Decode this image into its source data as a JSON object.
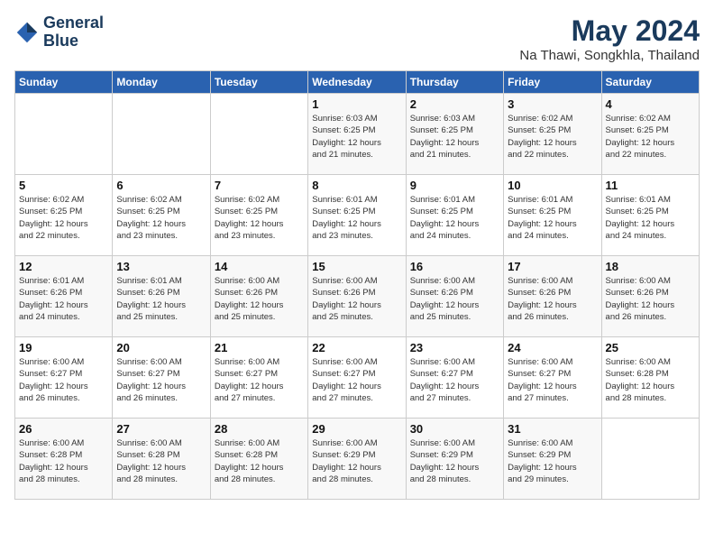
{
  "logo": {
    "line1": "General",
    "line2": "Blue"
  },
  "title": "May 2024",
  "subtitle": "Na Thawi, Songkhla, Thailand",
  "weekdays": [
    "Sunday",
    "Monday",
    "Tuesday",
    "Wednesday",
    "Thursday",
    "Friday",
    "Saturday"
  ],
  "weeks": [
    [
      {
        "day": "",
        "info": ""
      },
      {
        "day": "",
        "info": ""
      },
      {
        "day": "",
        "info": ""
      },
      {
        "day": "1",
        "info": "Sunrise: 6:03 AM\nSunset: 6:25 PM\nDaylight: 12 hours\nand 21 minutes."
      },
      {
        "day": "2",
        "info": "Sunrise: 6:03 AM\nSunset: 6:25 PM\nDaylight: 12 hours\nand 21 minutes."
      },
      {
        "day": "3",
        "info": "Sunrise: 6:02 AM\nSunset: 6:25 PM\nDaylight: 12 hours\nand 22 minutes."
      },
      {
        "day": "4",
        "info": "Sunrise: 6:02 AM\nSunset: 6:25 PM\nDaylight: 12 hours\nand 22 minutes."
      }
    ],
    [
      {
        "day": "5",
        "info": "Sunrise: 6:02 AM\nSunset: 6:25 PM\nDaylight: 12 hours\nand 22 minutes."
      },
      {
        "day": "6",
        "info": "Sunrise: 6:02 AM\nSunset: 6:25 PM\nDaylight: 12 hours\nand 23 minutes."
      },
      {
        "day": "7",
        "info": "Sunrise: 6:02 AM\nSunset: 6:25 PM\nDaylight: 12 hours\nand 23 minutes."
      },
      {
        "day": "8",
        "info": "Sunrise: 6:01 AM\nSunset: 6:25 PM\nDaylight: 12 hours\nand 23 minutes."
      },
      {
        "day": "9",
        "info": "Sunrise: 6:01 AM\nSunset: 6:25 PM\nDaylight: 12 hours\nand 24 minutes."
      },
      {
        "day": "10",
        "info": "Sunrise: 6:01 AM\nSunset: 6:25 PM\nDaylight: 12 hours\nand 24 minutes."
      },
      {
        "day": "11",
        "info": "Sunrise: 6:01 AM\nSunset: 6:25 PM\nDaylight: 12 hours\nand 24 minutes."
      }
    ],
    [
      {
        "day": "12",
        "info": "Sunrise: 6:01 AM\nSunset: 6:26 PM\nDaylight: 12 hours\nand 24 minutes."
      },
      {
        "day": "13",
        "info": "Sunrise: 6:01 AM\nSunset: 6:26 PM\nDaylight: 12 hours\nand 25 minutes."
      },
      {
        "day": "14",
        "info": "Sunrise: 6:00 AM\nSunset: 6:26 PM\nDaylight: 12 hours\nand 25 minutes."
      },
      {
        "day": "15",
        "info": "Sunrise: 6:00 AM\nSunset: 6:26 PM\nDaylight: 12 hours\nand 25 minutes."
      },
      {
        "day": "16",
        "info": "Sunrise: 6:00 AM\nSunset: 6:26 PM\nDaylight: 12 hours\nand 25 minutes."
      },
      {
        "day": "17",
        "info": "Sunrise: 6:00 AM\nSunset: 6:26 PM\nDaylight: 12 hours\nand 26 minutes."
      },
      {
        "day": "18",
        "info": "Sunrise: 6:00 AM\nSunset: 6:26 PM\nDaylight: 12 hours\nand 26 minutes."
      }
    ],
    [
      {
        "day": "19",
        "info": "Sunrise: 6:00 AM\nSunset: 6:27 PM\nDaylight: 12 hours\nand 26 minutes."
      },
      {
        "day": "20",
        "info": "Sunrise: 6:00 AM\nSunset: 6:27 PM\nDaylight: 12 hours\nand 26 minutes."
      },
      {
        "day": "21",
        "info": "Sunrise: 6:00 AM\nSunset: 6:27 PM\nDaylight: 12 hours\nand 27 minutes."
      },
      {
        "day": "22",
        "info": "Sunrise: 6:00 AM\nSunset: 6:27 PM\nDaylight: 12 hours\nand 27 minutes."
      },
      {
        "day": "23",
        "info": "Sunrise: 6:00 AM\nSunset: 6:27 PM\nDaylight: 12 hours\nand 27 minutes."
      },
      {
        "day": "24",
        "info": "Sunrise: 6:00 AM\nSunset: 6:27 PM\nDaylight: 12 hours\nand 27 minutes."
      },
      {
        "day": "25",
        "info": "Sunrise: 6:00 AM\nSunset: 6:28 PM\nDaylight: 12 hours\nand 28 minutes."
      }
    ],
    [
      {
        "day": "26",
        "info": "Sunrise: 6:00 AM\nSunset: 6:28 PM\nDaylight: 12 hours\nand 28 minutes."
      },
      {
        "day": "27",
        "info": "Sunrise: 6:00 AM\nSunset: 6:28 PM\nDaylight: 12 hours\nand 28 minutes."
      },
      {
        "day": "28",
        "info": "Sunrise: 6:00 AM\nSunset: 6:28 PM\nDaylight: 12 hours\nand 28 minutes."
      },
      {
        "day": "29",
        "info": "Sunrise: 6:00 AM\nSunset: 6:29 PM\nDaylight: 12 hours\nand 28 minutes."
      },
      {
        "day": "30",
        "info": "Sunrise: 6:00 AM\nSunset: 6:29 PM\nDaylight: 12 hours\nand 28 minutes."
      },
      {
        "day": "31",
        "info": "Sunrise: 6:00 AM\nSunset: 6:29 PM\nDaylight: 12 hours\nand 29 minutes."
      },
      {
        "day": "",
        "info": ""
      }
    ]
  ]
}
